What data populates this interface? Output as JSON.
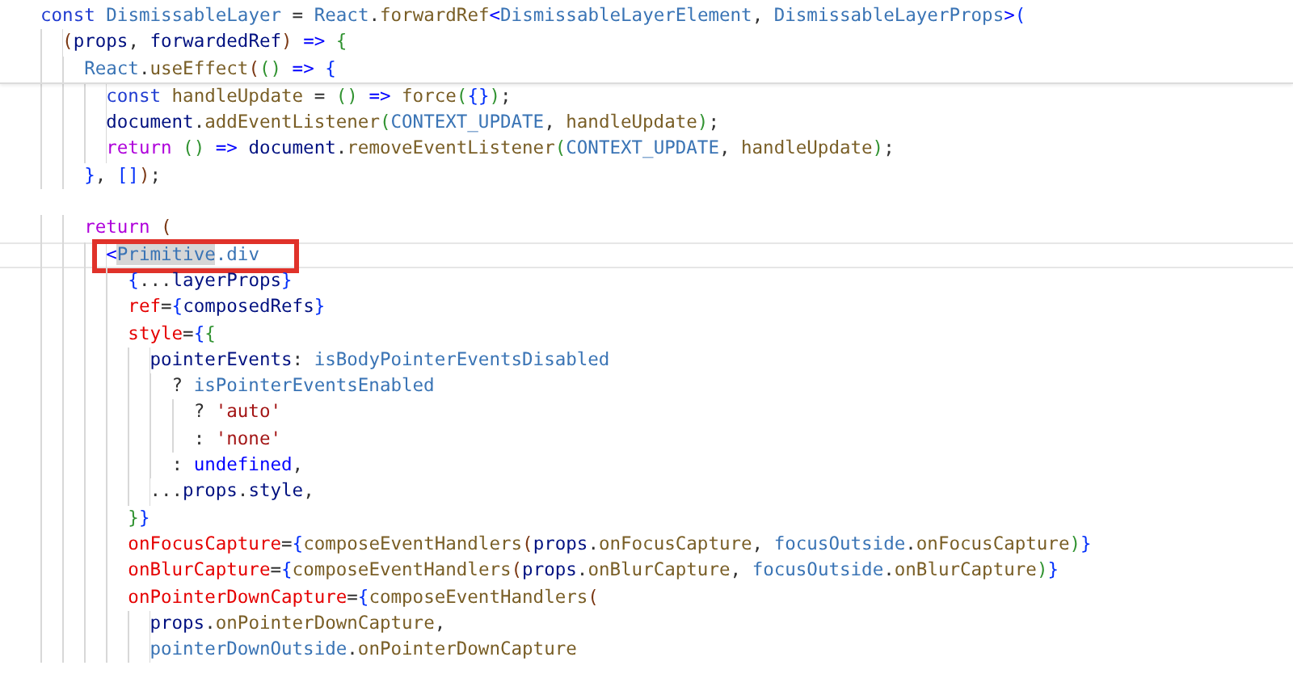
{
  "editor": {
    "sticky_lines": [
      {
        "tokens": [
          {
            "text": "const",
            "kind": "kw"
          },
          {
            "text": " DismissableLayer",
            "kind": "type"
          },
          {
            "text": " = ",
            "kind": "p"
          },
          {
            "text": "React",
            "kind": "type"
          },
          {
            "text": ".",
            "kind": "p"
          },
          {
            "text": "forwardRef",
            "kind": "fn"
          },
          {
            "text": "<",
            "kind": "lit"
          },
          {
            "text": "DismissableLayerElement",
            "kind": "type"
          },
          {
            "text": ", ",
            "kind": "p"
          },
          {
            "text": "DismissableLayerProps",
            "kind": "type"
          },
          {
            "text": ">",
            "kind": "lit"
          },
          {
            "text": "(",
            "kind": "b1"
          }
        ]
      },
      {
        "tokens": [
          {
            "text": "  (",
            "kind": "b3"
          },
          {
            "text": "props",
            "kind": "var"
          },
          {
            "text": ", ",
            "kind": "p"
          },
          {
            "text": "forwardedRef",
            "kind": "var"
          },
          {
            "text": ")",
            "kind": "b3"
          },
          {
            "text": " => ",
            "kind": "lit"
          },
          {
            "text": "{",
            "kind": "b2"
          }
        ]
      },
      {
        "tokens": [
          {
            "text": "    React",
            "kind": "type"
          },
          {
            "text": ".",
            "kind": "p"
          },
          {
            "text": "useEffect",
            "kind": "fn"
          },
          {
            "text": "(",
            "kind": "b3"
          },
          {
            "text": "()",
            "kind": "b2"
          },
          {
            "text": " => ",
            "kind": "lit"
          },
          {
            "text": "{",
            "kind": "b1"
          }
        ]
      }
    ],
    "lines": [
      {
        "tokens": [
          {
            "text": "      const",
            "kind": "kw"
          },
          {
            "text": " handleUpdate",
            "kind": "fn"
          },
          {
            "text": " = ",
            "kind": "p"
          },
          {
            "text": "()",
            "kind": "b2"
          },
          {
            "text": " => ",
            "kind": "lit"
          },
          {
            "text": "force",
            "kind": "fn"
          },
          {
            "text": "(",
            "kind": "b2"
          },
          {
            "text": "{}",
            "kind": "b1"
          },
          {
            "text": ")",
            "kind": "b2"
          },
          {
            "text": ";",
            "kind": "p"
          }
        ]
      },
      {
        "tokens": [
          {
            "text": "      document",
            "kind": "var"
          },
          {
            "text": ".",
            "kind": "p"
          },
          {
            "text": "addEventListener",
            "kind": "fn"
          },
          {
            "text": "(",
            "kind": "b2"
          },
          {
            "text": "CONTEXT_UPDATE",
            "kind": "type"
          },
          {
            "text": ", ",
            "kind": "p"
          },
          {
            "text": "handleUpdate",
            "kind": "fn"
          },
          {
            "text": ")",
            "kind": "b2"
          },
          {
            "text": ";",
            "kind": "p"
          }
        ]
      },
      {
        "tokens": [
          {
            "text": "      return ",
            "kind": "ret"
          },
          {
            "text": "()",
            "kind": "b2"
          },
          {
            "text": " => ",
            "kind": "lit"
          },
          {
            "text": "document",
            "kind": "var"
          },
          {
            "text": ".",
            "kind": "p"
          },
          {
            "text": "removeEventListener",
            "kind": "fn"
          },
          {
            "text": "(",
            "kind": "b2"
          },
          {
            "text": "CONTEXT_UPDATE",
            "kind": "type"
          },
          {
            "text": ", ",
            "kind": "p"
          },
          {
            "text": "handleUpdate",
            "kind": "fn"
          },
          {
            "text": ")",
            "kind": "b2"
          },
          {
            "text": ";",
            "kind": "p"
          }
        ]
      },
      {
        "tokens": [
          {
            "text": "    }",
            "kind": "b1"
          },
          {
            "text": ", ",
            "kind": "p"
          },
          {
            "text": "[]",
            "kind": "b1"
          },
          {
            "text": ")",
            "kind": "b3"
          },
          {
            "text": ";",
            "kind": "p"
          }
        ]
      },
      {
        "kind": "blank"
      },
      {
        "tokens": [
          {
            "text": "    return ",
            "kind": "ret"
          },
          {
            "text": "(",
            "kind": "b3"
          }
        ]
      },
      {
        "current": true,
        "annotated": true,
        "tokens": [
          {
            "text": "      <",
            "kind": "lit"
          },
          {
            "text": "Primitive",
            "kind": "type",
            "selected": true
          },
          {
            "text": ".div",
            "kind": "type"
          }
        ]
      },
      {
        "tokens": [
          {
            "text": "        {",
            "kind": "b1"
          },
          {
            "text": "...",
            "kind": "p"
          },
          {
            "text": "layerProps",
            "kind": "var"
          },
          {
            "text": "}",
            "kind": "b1"
          }
        ]
      },
      {
        "tokens": [
          {
            "text": "        ref",
            "kind": "attr"
          },
          {
            "text": "=",
            "kind": "p"
          },
          {
            "text": "{",
            "kind": "b1"
          },
          {
            "text": "composedRefs",
            "kind": "var"
          },
          {
            "text": "}",
            "kind": "b1"
          }
        ]
      },
      {
        "tokens": [
          {
            "text": "        style",
            "kind": "attr"
          },
          {
            "text": "=",
            "kind": "p"
          },
          {
            "text": "{",
            "kind": "b1"
          },
          {
            "text": "{",
            "kind": "b2"
          }
        ]
      },
      {
        "tokens": [
          {
            "text": "          pointerEvents",
            "kind": "var"
          },
          {
            "text": ": ",
            "kind": "p"
          },
          {
            "text": "isBodyPointerEventsDisabled",
            "kind": "type"
          }
        ]
      },
      {
        "tokens": [
          {
            "text": "            ? ",
            "kind": "p"
          },
          {
            "text": "isPointerEventsEnabled",
            "kind": "type"
          }
        ]
      },
      {
        "tokens": [
          {
            "text": "              ? ",
            "kind": "p"
          },
          {
            "text": "'auto'",
            "kind": "str"
          }
        ]
      },
      {
        "tokens": [
          {
            "text": "              : ",
            "kind": "p"
          },
          {
            "text": "'none'",
            "kind": "str"
          }
        ]
      },
      {
        "tokens": [
          {
            "text": "            : ",
            "kind": "p"
          },
          {
            "text": "undefined",
            "kind": "lit"
          },
          {
            "text": ",",
            "kind": "p"
          }
        ]
      },
      {
        "tokens": [
          {
            "text": "          ...",
            "kind": "p"
          },
          {
            "text": "props",
            "kind": "var"
          },
          {
            "text": ".",
            "kind": "p"
          },
          {
            "text": "style",
            "kind": "var"
          },
          {
            "text": ",",
            "kind": "p"
          }
        ]
      },
      {
        "tokens": [
          {
            "text": "        }",
            "kind": "b2"
          },
          {
            "text": "}",
            "kind": "b1"
          }
        ]
      },
      {
        "tokens": [
          {
            "text": "        onFocusCapture",
            "kind": "attr"
          },
          {
            "text": "=",
            "kind": "p"
          },
          {
            "text": "{",
            "kind": "b1"
          },
          {
            "text": "composeEventHandlers",
            "kind": "fn"
          },
          {
            "text": "(",
            "kind": "b3"
          },
          {
            "text": "props",
            "kind": "var"
          },
          {
            "text": ".",
            "kind": "p"
          },
          {
            "text": "onFocusCapture",
            "kind": "fn"
          },
          {
            "text": ", ",
            "kind": "p"
          },
          {
            "text": "focusOutside",
            "kind": "type"
          },
          {
            "text": ".",
            "kind": "p"
          },
          {
            "text": "onFocusCapture",
            "kind": "fn"
          },
          {
            "text": ")",
            "kind": "b2"
          },
          {
            "text": "}",
            "kind": "b1"
          }
        ]
      },
      {
        "tokens": [
          {
            "text": "        onBlurCapture",
            "kind": "attr"
          },
          {
            "text": "=",
            "kind": "p"
          },
          {
            "text": "{",
            "kind": "b1"
          },
          {
            "text": "composeEventHandlers",
            "kind": "fn"
          },
          {
            "text": "(",
            "kind": "b3"
          },
          {
            "text": "props",
            "kind": "var"
          },
          {
            "text": ".",
            "kind": "p"
          },
          {
            "text": "onBlurCapture",
            "kind": "fn"
          },
          {
            "text": ", ",
            "kind": "p"
          },
          {
            "text": "focusOutside",
            "kind": "type"
          },
          {
            "text": ".",
            "kind": "p"
          },
          {
            "text": "onBlurCapture",
            "kind": "fn"
          },
          {
            "text": ")",
            "kind": "b2"
          },
          {
            "text": "}",
            "kind": "b1"
          }
        ]
      },
      {
        "tokens": [
          {
            "text": "        onPointerDownCapture",
            "kind": "attr"
          },
          {
            "text": "=",
            "kind": "p"
          },
          {
            "text": "{",
            "kind": "b1"
          },
          {
            "text": "composeEventHandlers",
            "kind": "fn"
          },
          {
            "text": "(",
            "kind": "b3"
          }
        ]
      },
      {
        "tokens": [
          {
            "text": "          props",
            "kind": "var"
          },
          {
            "text": ".",
            "kind": "p"
          },
          {
            "text": "onPointerDownCapture",
            "kind": "fn"
          },
          {
            "text": ",",
            "kind": "p"
          }
        ]
      },
      {
        "tokens": [
          {
            "text": "          pointerDownOutside",
            "kind": "type"
          },
          {
            "text": ".",
            "kind": "p"
          },
          {
            "text": "onPointerDownCapture",
            "kind": "fn"
          }
        ]
      }
    ]
  }
}
